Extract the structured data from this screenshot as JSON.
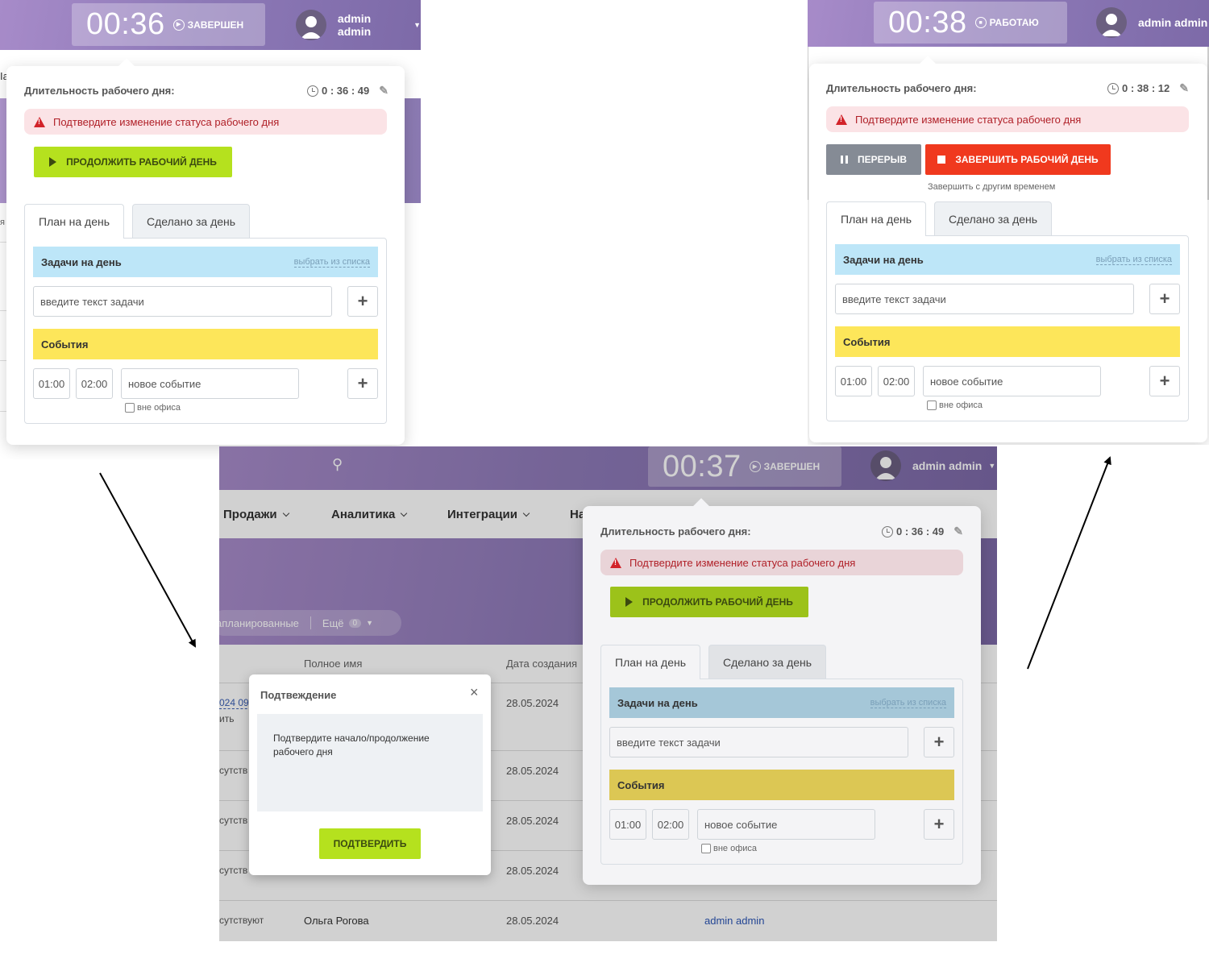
{
  "left_panel": {
    "timer": "00:36",
    "status": "ЗАВЕРШЕН",
    "user": "admin admin",
    "duration_label": "Длительность рабочего дня:",
    "duration_value": "0 : 36 : 49",
    "alert": "Подтвердите изменение статуса рабочего дня",
    "continue_button": "ПРОДОЛЖИТЬ РАБОЧИЙ ДЕНЬ",
    "tab_plan": "План на день",
    "tab_done": "Сделано за день",
    "tasks_title": "Задачи на день",
    "tasks_link": "выбрать из списка",
    "task_placeholder": "введите текст задачи",
    "events_title": "События",
    "time_from": "01:00",
    "time_to": "02:00",
    "event_placeholder": "новое событие",
    "offsite_label": "вне офиса",
    "cut_text_1": "Ia",
    "cut_text_2": "я"
  },
  "right_panel": {
    "timer": "00:38",
    "status": "РАБОТАЮ",
    "user": "admin admin",
    "duration_label": "Длительность рабочего дня:",
    "duration_value": "0 : 38 : 12",
    "alert": "Подтвердите изменение статуса рабочего дня",
    "pause_button": "ПЕРЕРЫВ",
    "finish_button": "ЗАВЕРШИТЬ РАБОЧИЙ ДЕНЬ",
    "finish_other_time": "Завершить с другим временем",
    "tab_plan": "План на день",
    "tab_done": "Сделано за день",
    "tasks_title": "Задачи на день",
    "tasks_link": "выбрать из списка",
    "task_placeholder": "введите текст задачи",
    "events_title": "События",
    "time_from": "01:00",
    "time_to": "02:00",
    "event_placeholder": "новое событие",
    "offsite_label": "вне офиса"
  },
  "middle": {
    "timer": "00:37",
    "status": "ЗАВЕРШЕН",
    "user": "admin admin",
    "nav": [
      "Продажи",
      "Аналитика",
      "Интеграции",
      "На"
    ],
    "filter_planned": "апланированные",
    "filter_more": "Ещё",
    "filter_more_count": "0",
    "table_headers": [
      "Полное имя",
      "Дата создания"
    ],
    "rows": [
      {
        "left": "024 09:",
        "left2": "ить",
        "name": "",
        "date": "28.05.2024"
      },
      {
        "left": "сутств",
        "left2": "",
        "name": "",
        "date": "28.05.2024"
      },
      {
        "left": "сутств",
        "left2": "",
        "name": "",
        "date": "28.05.2024"
      },
      {
        "left": "сутств",
        "left2": "",
        "name": "",
        "date": "28.05.2024"
      },
      {
        "left": "сутствуют",
        "left2": "",
        "name": "Ольга Рогова",
        "date": "28.05.2024",
        "owner": "admin admin"
      }
    ],
    "popup": {
      "duration_label": "Длительность рабочего дня:",
      "duration_value": "0 : 36 : 49",
      "alert": "Подтвердите изменение статуса рабочего дня",
      "continue_button": "ПРОДОЛЖИТЬ РАБОЧИЙ ДЕНЬ",
      "tab_plan": "План на день",
      "tab_done": "Сделано за день",
      "tasks_title": "Задачи на день",
      "tasks_link": "выбрать из списка",
      "task_placeholder": "введите текст задачи",
      "events_title": "События",
      "time_from": "01:00",
      "time_to": "02:00",
      "event_placeholder": "новое событие",
      "offsite_label": "вне офиса"
    },
    "modal": {
      "title": "Подтвеждение",
      "close": "×",
      "body": "Подтвердите начало/продолжение рабочего дня",
      "confirm_button": "ПОДТВЕРДИТЬ"
    }
  },
  "colors": {
    "accent_green": "#b5e11e",
    "danger_red": "#f0391e",
    "alert_bg": "#fbe3e6",
    "tasks_bg": "#bde6f8",
    "events_bg": "#fde65a",
    "header_purple": "#8e7ab8"
  }
}
